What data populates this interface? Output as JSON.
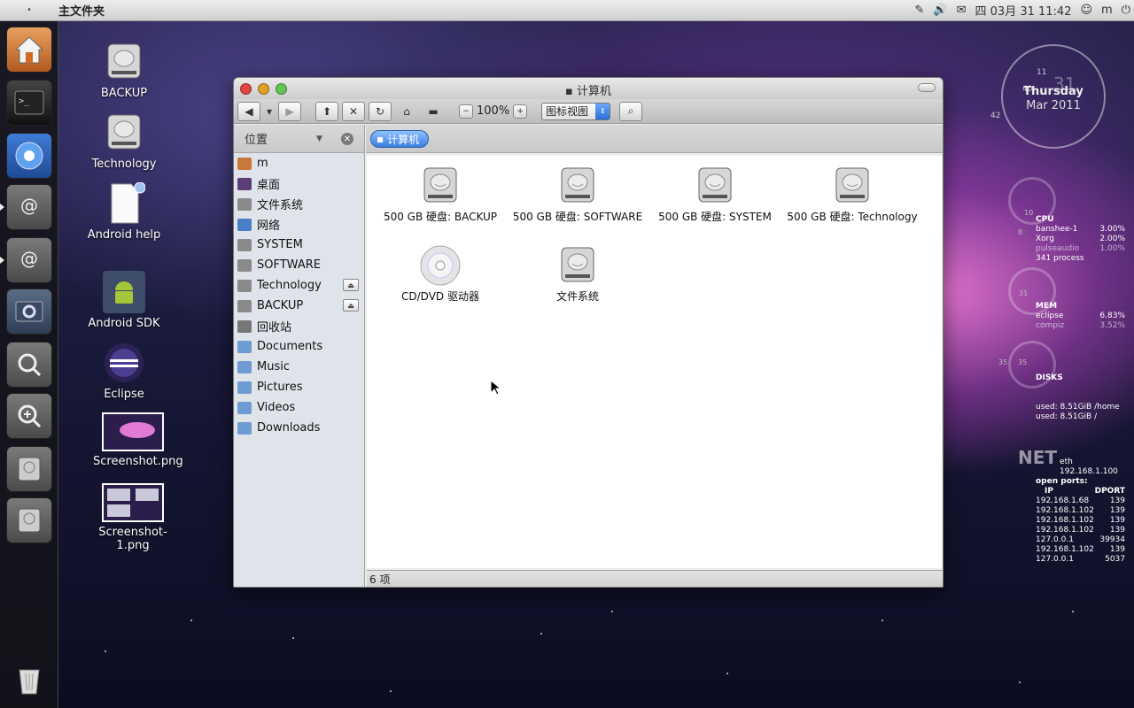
{
  "topbar": {
    "app_title": "主文件夹",
    "datetime": "四 03月 31 11:42",
    "user": "m",
    "indicators": [
      "pen-icon",
      "volume-icon",
      "mail-icon",
      "chat-icon",
      "power-icon"
    ]
  },
  "desktop_icons": [
    {
      "label": "BACKUP",
      "icon": "drive-icon"
    },
    {
      "label": "Technology",
      "icon": "drive-icon"
    },
    {
      "label": "Android help",
      "icon": "file-icon"
    },
    {
      "label": "Android SDK",
      "icon": "android-icon"
    },
    {
      "label": "Eclipse",
      "icon": "eclipse-icon"
    },
    {
      "label": "Screenshot.png",
      "icon": "image-icon"
    },
    {
      "label": "Screenshot-1.png",
      "icon": "image-icon"
    }
  ],
  "window": {
    "title": "计算机",
    "zoom": "100%",
    "view_mode": "图标视图",
    "sidebar_header": "位置",
    "breadcrumb": "计算机",
    "status": "6 项",
    "sidebar_items": [
      {
        "label": "m",
        "icon": "home-icon"
      },
      {
        "label": "桌面",
        "icon": "desktop-icon"
      },
      {
        "label": "文件系统",
        "icon": "drive-icon"
      },
      {
        "label": "网络",
        "icon": "network-icon"
      },
      {
        "label": "SYSTEM",
        "icon": "drive-icon"
      },
      {
        "label": "SOFTWARE",
        "icon": "drive-icon"
      },
      {
        "label": "Technology",
        "icon": "drive-icon",
        "eject": true
      },
      {
        "label": "BACKUP",
        "icon": "drive-icon",
        "eject": true
      },
      {
        "label": "回收站",
        "icon": "trash-icon"
      },
      {
        "label": "Documents",
        "icon": "folder-icon"
      },
      {
        "label": "Music",
        "icon": "folder-icon"
      },
      {
        "label": "Pictures",
        "icon": "folder-icon"
      },
      {
        "label": "Videos",
        "icon": "folder-icon"
      },
      {
        "label": "Downloads",
        "icon": "folder-icon"
      }
    ],
    "files": [
      {
        "label": "500 GB 硬盘: BACKUP",
        "icon": "drive-icon"
      },
      {
        "label": "500 GB 硬盘: SOFTWARE",
        "icon": "drive-icon"
      },
      {
        "label": "500 GB 硬盘: SYSTEM",
        "icon": "drive-icon"
      },
      {
        "label": "500 GB 硬盘: Technology",
        "icon": "drive-icon"
      },
      {
        "label": "CD/DVD 驱动器",
        "icon": "cd-icon"
      },
      {
        "label": "文件系统",
        "icon": "drive-icon"
      }
    ]
  },
  "clock": {
    "hour": "11",
    "minute": "42",
    "day_num": "31",
    "weekday": "Thursday",
    "month_year": "Mar 2011",
    "sec": "40"
  },
  "conky": {
    "cpu_title": "CPU",
    "cpu_procs": [
      {
        "name": "banshee-1",
        "val": "3.00%"
      },
      {
        "name": "Xorg",
        "val": "2.00%"
      },
      {
        "name": "pulseaudio",
        "val": "1.00%"
      }
    ],
    "processes": "341 process",
    "cpu_ring": "10",
    "cpu_ring_small": "8",
    "mem_title": "MEM",
    "mem_procs": [
      {
        "name": "eclipse",
        "val": "6.83%"
      },
      {
        "name": "compiz",
        "val": "3.52%"
      }
    ],
    "mem_ring": "31",
    "disks_title": "DISKS",
    "disk_ring_a": "35",
    "disk_ring_b": "35",
    "disk_used": [
      "used: 8.51GiB /home",
      "used: 8.51GiB /"
    ],
    "net_title": "NET",
    "net_iface": "eth 192.168.1.100",
    "open_ports": "open ports:",
    "col_ip": "IP",
    "col_dport": "DPORT",
    "ports": [
      {
        "ip": "192.168.1.68",
        "port": "139"
      },
      {
        "ip": "192.168.1.102",
        "port": "139"
      },
      {
        "ip": "192.168.1.102",
        "port": "139"
      },
      {
        "ip": "192.168.1.102",
        "port": "139"
      },
      {
        "ip": "127.0.0.1",
        "port": "39934"
      },
      {
        "ip": "192.168.1.102",
        "port": "139"
      },
      {
        "ip": "127.0.0.1",
        "port": "5037"
      }
    ]
  }
}
